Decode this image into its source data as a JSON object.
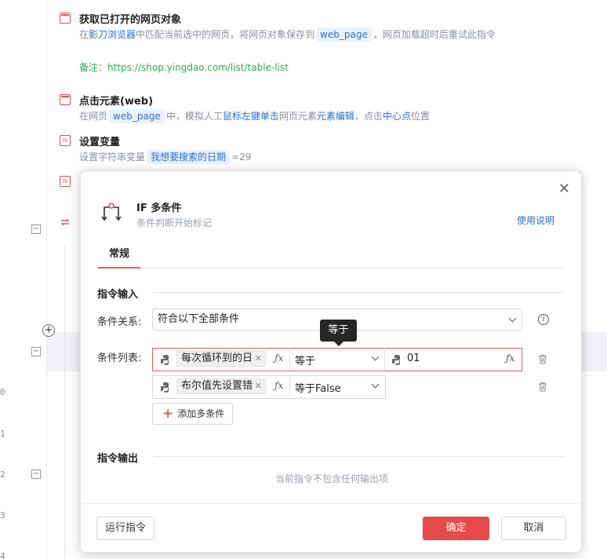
{
  "editor": {
    "line_numbers": [
      "0",
      "1",
      "2",
      "3",
      "4"
    ],
    "steps": [
      {
        "title": "获取已打开的网页对象",
        "desc_parts": [
          "在",
          "影刀浏览器",
          "中匹配当前选中的网页，将网页对象保存到",
          "web_page",
          "，网页加载超时后重试此指令"
        ],
        "note": "备注：https://shop.yingdao.com/list/table-list"
      },
      {
        "title": "点击元素(web)",
        "desc_parts": [
          "在网页",
          "web_page",
          "中，模拟人工",
          "鼠标左键单击",
          "网页元素",
          "元素编辑",
          "，点击",
          "中心点",
          "位置"
        ]
      },
      {
        "title": "设置变量",
        "desc_parts": [
          "设置字符串变量",
          "我想要搜索的日期",
          "=29"
        ]
      }
    ]
  },
  "dialog": {
    "title": "IF 多条件",
    "subtitle": "条件判断开始标记",
    "help_link": "使用说明",
    "tab": "常规",
    "input_section": "指令输入",
    "relation_label": "条件关系:",
    "relation_value": "符合以下全部条件",
    "list_label": "条件列表:",
    "conditions": [
      {
        "variable": "每次循环到的日",
        "operator": "等于",
        "value": "01",
        "has_value": true,
        "error": true
      },
      {
        "variable": "布尔值先设置错",
        "operator": "等于False",
        "has_value": false,
        "error": false
      }
    ],
    "add_condition": "添加多条件",
    "output_section": "指令输出",
    "output_empty": "当前指令不包含任何输出项",
    "tooltip": "等于",
    "buttons": {
      "run": "运行指令",
      "confirm": "确定",
      "cancel": "取消"
    }
  },
  "colors": {
    "accent_red": "#e84a4a",
    "link_blue": "#2b6fd6",
    "note_green": "#2eaa5a"
  }
}
